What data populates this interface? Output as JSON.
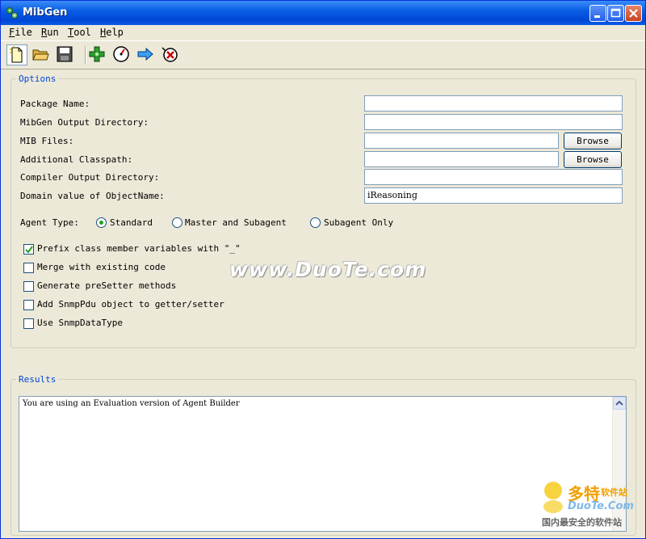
{
  "window": {
    "title": "MibGen"
  },
  "menu": [
    {
      "label": "File",
      "mnemonic": "F",
      "rest": "ile"
    },
    {
      "label": "Run",
      "mnemonic": "R",
      "rest": "un"
    },
    {
      "label": "Tool",
      "mnemonic": "T",
      "rest": "ool"
    },
    {
      "label": "Help",
      "mnemonic": "H",
      "rest": "elp"
    }
  ],
  "toolbar": {
    "icons": [
      "new-file-icon",
      "open-folder-icon",
      "save-disk-icon",
      "add-icon",
      "gauge-icon",
      "arrow-right-icon",
      "stop-icon"
    ]
  },
  "options": {
    "title": "Options",
    "fields": {
      "package_name": {
        "label": "Package Name:",
        "value": ""
      },
      "output_dir": {
        "label": "MibGen Output Directory:",
        "value": ""
      },
      "mib_files": {
        "label": "MIB Files:",
        "value": "",
        "button": "Browse"
      },
      "classpath": {
        "label": "Additional Classpath:",
        "value": "",
        "button": "Browse"
      },
      "compiler_dir": {
        "label": "Compiler Output Directory:",
        "value": ""
      },
      "domain_value": {
        "label": "Domain value of ObjectName:",
        "value": "iReasoning"
      }
    },
    "agent_type": {
      "label": "Agent Type:",
      "options": [
        "Standard",
        "Master and Subagent",
        "Subagent Only"
      ],
      "selected": "Standard"
    },
    "checkboxes": [
      {
        "label": "Prefix class member variables with \"_\"",
        "checked": true
      },
      {
        "label": "Merge with existing code",
        "checked": false
      },
      {
        "label": "Generate preSetter methods",
        "checked": false
      },
      {
        "label": "Add SnmpPdu object to getter/setter",
        "checked": false
      },
      {
        "label": "Use SnmpDataType",
        "checked": false
      }
    ]
  },
  "results": {
    "title": "Results",
    "text": "You are using an Evaluation version of Agent Builder"
  },
  "watermark": {
    "text": "www.DuoTe.com",
    "brand": "多特",
    "brand_small": "软件站",
    "brand_url": "DuoTe.Com",
    "tagline": "国内最安全的软件站"
  },
  "colors": {
    "titlebar": "#0a5ee6",
    "legend": "#0046d5",
    "window_bg": "#ece9d8"
  }
}
